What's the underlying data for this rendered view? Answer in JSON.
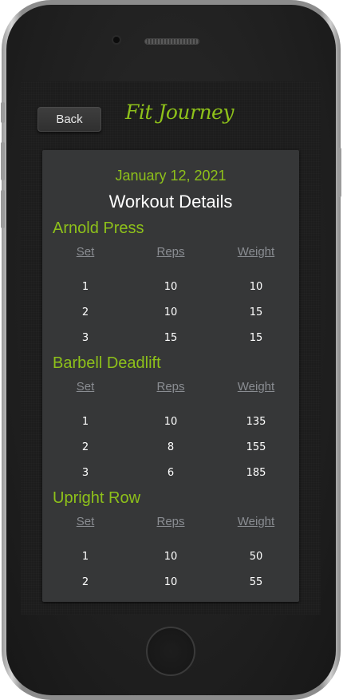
{
  "app": {
    "title": "Fit Journey",
    "back_label": "Back",
    "accent_color": "#8ec11a"
  },
  "workout": {
    "date": "January 12, 2021",
    "title": "Workout Details",
    "columns": [
      "Set",
      "Reps",
      "Weight"
    ],
    "exercises": [
      {
        "name": "Arnold Press",
        "rows": [
          {
            "set": "1",
            "reps": "10",
            "weight": "10"
          },
          {
            "set": "2",
            "reps": "10",
            "weight": "15"
          },
          {
            "set": "3",
            "reps": "15",
            "weight": "15"
          }
        ]
      },
      {
        "name": "Barbell Deadlift",
        "rows": [
          {
            "set": "1",
            "reps": "10",
            "weight": "135"
          },
          {
            "set": "2",
            "reps": "8",
            "weight": "155"
          },
          {
            "set": "3",
            "reps": "6",
            "weight": "185"
          }
        ]
      },
      {
        "name": "Upright Row",
        "rows": [
          {
            "set": "1",
            "reps": "10",
            "weight": "50"
          },
          {
            "set": "2",
            "reps": "10",
            "weight": "55"
          }
        ]
      }
    ]
  }
}
